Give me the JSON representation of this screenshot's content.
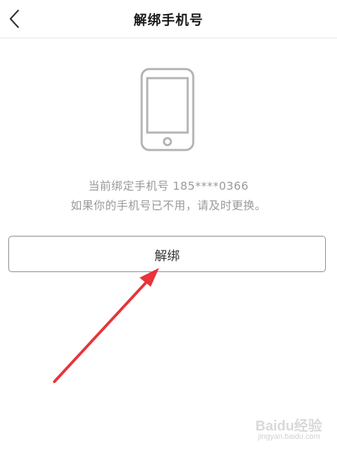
{
  "nav": {
    "title": "解绑手机号",
    "back_icon": "chevron-left-icon"
  },
  "content": {
    "phone_icon": "smartphone-icon",
    "bound_phone_line": "当前绑定手机号 185****0366",
    "advice_line": "如果你的手机号已不用，请及时更换。"
  },
  "actions": {
    "unbind_label": "解绑"
  },
  "annotation": {
    "arrow_color": "#e8343a"
  },
  "watermark": {
    "brand": "Baidu经验",
    "url": "jingyan.baidu.com"
  },
  "colors": {
    "title": "#1a1a1a",
    "secondary_text": "#9a9a9a",
    "icon_stroke": "#b3b3b3",
    "button_border": "#8c8c8c",
    "divider": "#e6e6e6"
  }
}
